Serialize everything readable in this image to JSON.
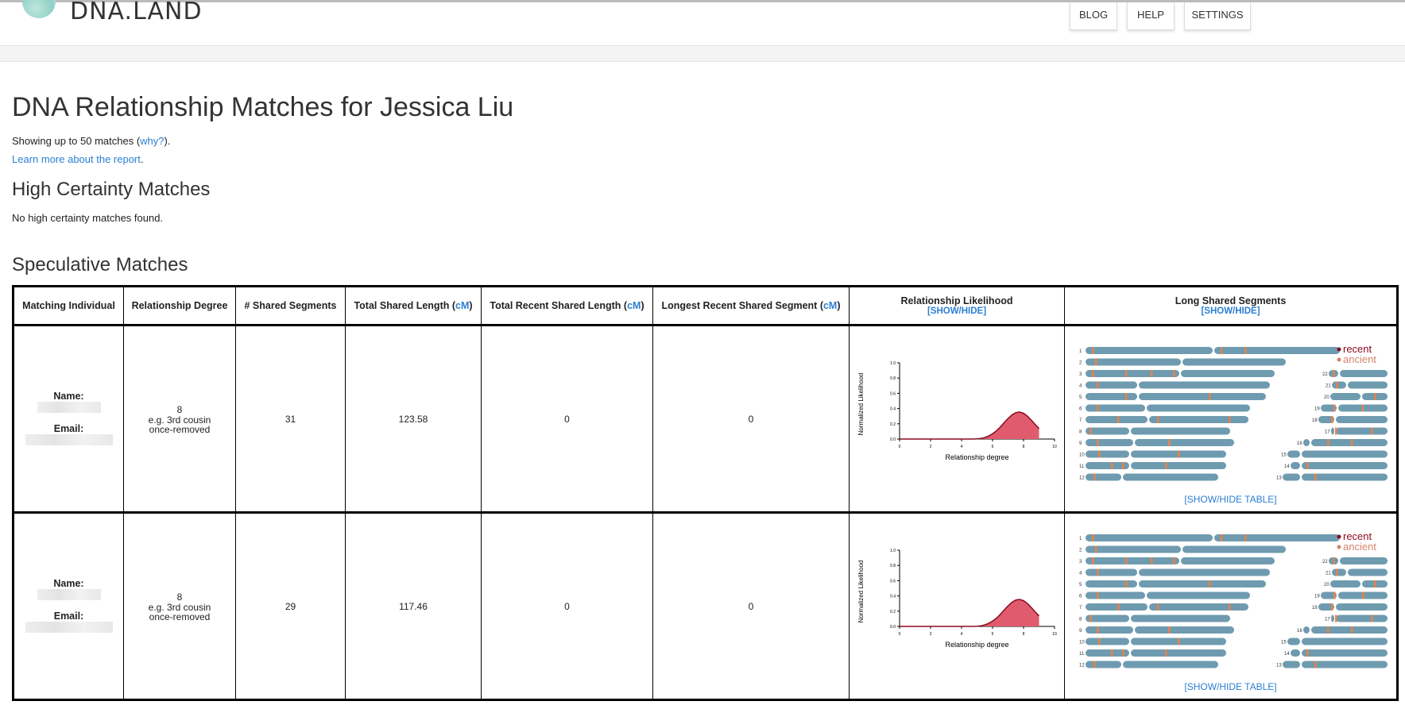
{
  "header": {
    "logo_text": "DNA.LAND",
    "nav": [
      "BLOG",
      "HELP",
      "SETTINGS"
    ]
  },
  "page": {
    "title": "DNA Relationship Matches for Jessica Liu",
    "showing_prefix": "Showing up to 50 matches (",
    "why_link": "why?",
    "showing_suffix": ").",
    "learn_link": "Learn more about the report",
    "learn_suffix": ".",
    "high_title": "High Certainty Matches",
    "high_none": "No high certainty matches found.",
    "spec_title": "Speculative Matches"
  },
  "table": {
    "headers": {
      "individual": "Matching Individual",
      "degree": "Relationship Degree",
      "segments": "# Shared Segments",
      "total_prefix": "Total Shared Length (",
      "recent_prefix": "Total Recent Shared Length (",
      "longest_prefix": "Longest Recent Shared Segment (",
      "cm": "cM",
      "close": ")",
      "likelihood": "Relationship Likelihood",
      "long_segments": "Long Shared Segments",
      "show_hide": "[SHOW/HIDE]"
    },
    "name_label": "Name:",
    "email_label": "Email:",
    "rows": [
      {
        "degree": "8",
        "degree_example": "e.g. 3rd cousin once-removed",
        "segments": "31",
        "total": "123.58",
        "recent": "0",
        "longest": "0"
      },
      {
        "degree": "8",
        "degree_example": "e.g. 3rd cousin once-removed",
        "segments": "29",
        "total": "117.46",
        "recent": "0",
        "longest": "0"
      }
    ],
    "plot": {
      "ylabel": "Normalized Likelihood",
      "xlabel": "Relationship degree",
      "yticks": [
        "0.0",
        "0.2",
        "0.4",
        "0.6",
        "0.8",
        "1.0"
      ],
      "xticks": [
        "0",
        "2",
        "4",
        "6",
        "8",
        "10"
      ]
    },
    "legend": {
      "recent": "recent",
      "ancient": "ancient"
    },
    "chromosome_labels_left": [
      "1",
      "2",
      "3",
      "4",
      "5",
      "6",
      "7",
      "8",
      "9",
      "10",
      "11",
      "12"
    ],
    "chromosome_labels_right": [
      "22",
      "21",
      "20",
      "19",
      "18",
      "17",
      "16",
      "15",
      "14",
      "13"
    ],
    "show_hide_table": "[SHOW/HIDE TABLE]"
  },
  "colors": {
    "accent": "#2b7fd3",
    "curve_fill": "#e15b6e",
    "curve_stroke": "#8b0a1f",
    "chromosome": "#6f9bb0",
    "segment": "#e7834a",
    "recent": "#8b0a1f",
    "ancient": "#d4846a"
  }
}
